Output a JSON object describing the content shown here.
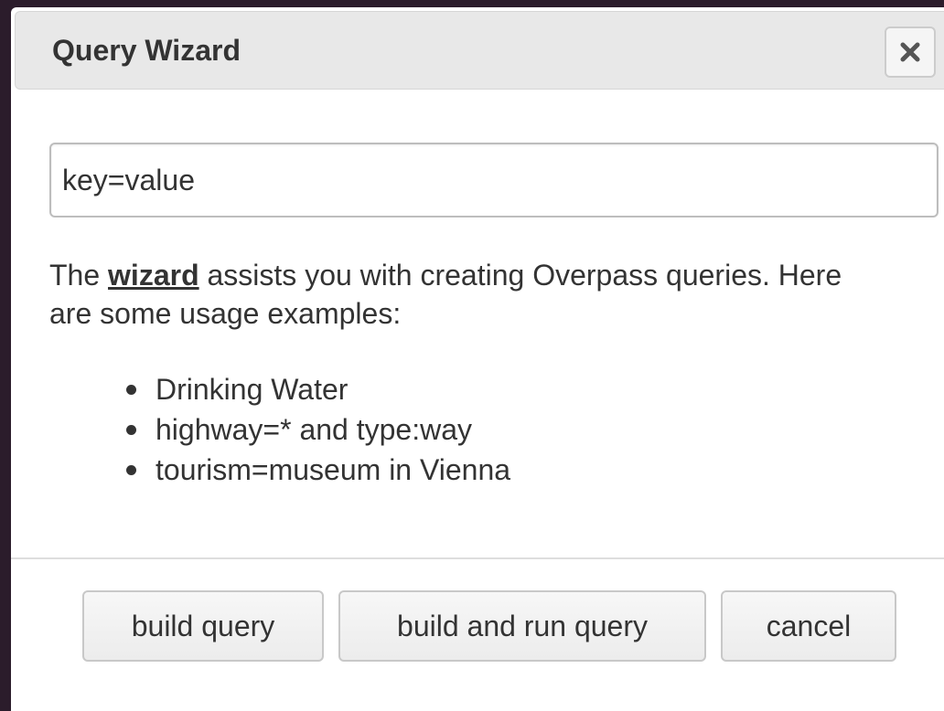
{
  "dialog": {
    "title": "Query Wizard",
    "close_icon": "close-x-icon"
  },
  "search": {
    "value": "key=value"
  },
  "description": {
    "prefix": "The ",
    "link_text": "wizard",
    "suffix": " assists you with creating Overpass queries. Here are some usage examples:"
  },
  "examples": [
    "Drinking Water",
    "highway=* and type:way",
    "tourism=museum in Vienna"
  ],
  "buttons": {
    "build": "build query",
    "build_run": "build and run query",
    "cancel": "cancel"
  },
  "colors": {
    "backdrop": "#2b1c2b",
    "titlebar": "#e8e8e8",
    "text": "#333333"
  }
}
